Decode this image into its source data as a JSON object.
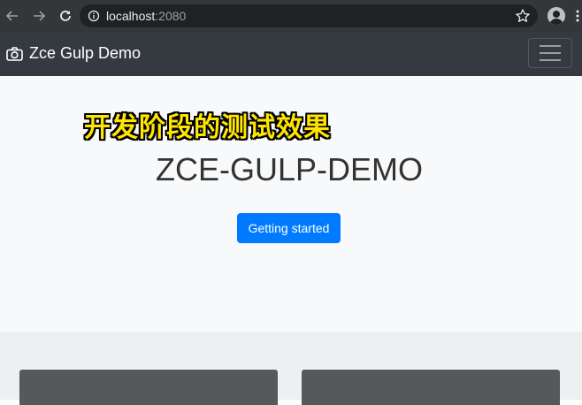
{
  "browser": {
    "url_host": "localhost",
    "url_port": ":2080",
    "icons": [
      "back-arrow-icon",
      "forward-arrow-icon",
      "reload-icon",
      "info-icon",
      "star-icon",
      "avatar",
      "kebab-menu-icon"
    ]
  },
  "navbar": {
    "brand_label": "Zce Gulp Demo",
    "brand_icon": "camera-icon",
    "toggler_icon": "hamburger-icon"
  },
  "hero": {
    "overlay_caption": "开发阶段的测试效果",
    "title": "ZCE-GULP-DEMO",
    "cta_label": "Getting started"
  },
  "colors": {
    "chrome": "#35363a",
    "navbar": "#343a40",
    "primary": "#007bff",
    "caption": "#ffe500",
    "card": "#55595c"
  }
}
